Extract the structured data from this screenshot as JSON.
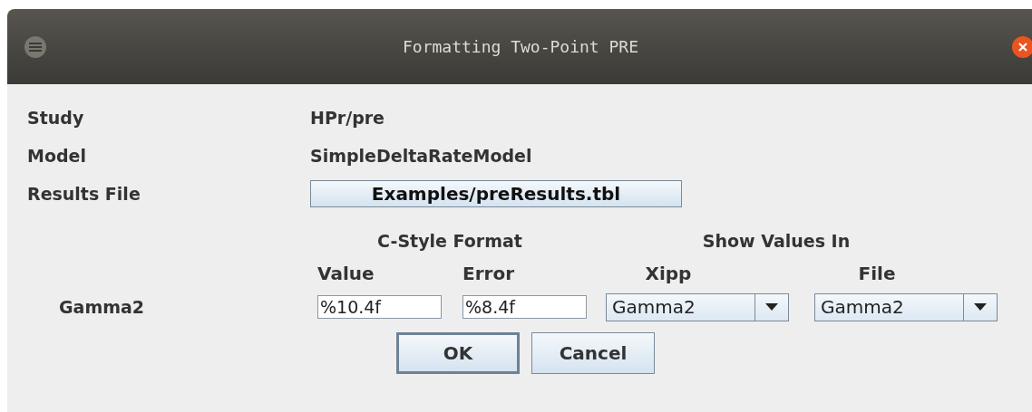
{
  "window": {
    "title": "Formatting Two-Point PRE"
  },
  "fields": [
    {
      "label": "Study",
      "value": "HPr/pre",
      "kind": "text"
    },
    {
      "label": "Model",
      "value": "SimpleDeltaRateModel",
      "kind": "text"
    },
    {
      "label": "Results File",
      "value": "Examples/preResults.tbl",
      "kind": "button"
    }
  ],
  "group_headings": [
    "C-Style Format",
    "Show Values In"
  ],
  "columns": [
    "Value",
    "Error",
    "Xipp",
    "File"
  ],
  "row": {
    "label": "Gamma2",
    "value_format": "%10.4f",
    "error_format": "%8.4f",
    "xipp": "Gamma2",
    "file": "Gamma2"
  },
  "buttons": [
    {
      "label": "OK",
      "selected": true
    },
    {
      "label": "Cancel",
      "selected": false
    }
  ]
}
